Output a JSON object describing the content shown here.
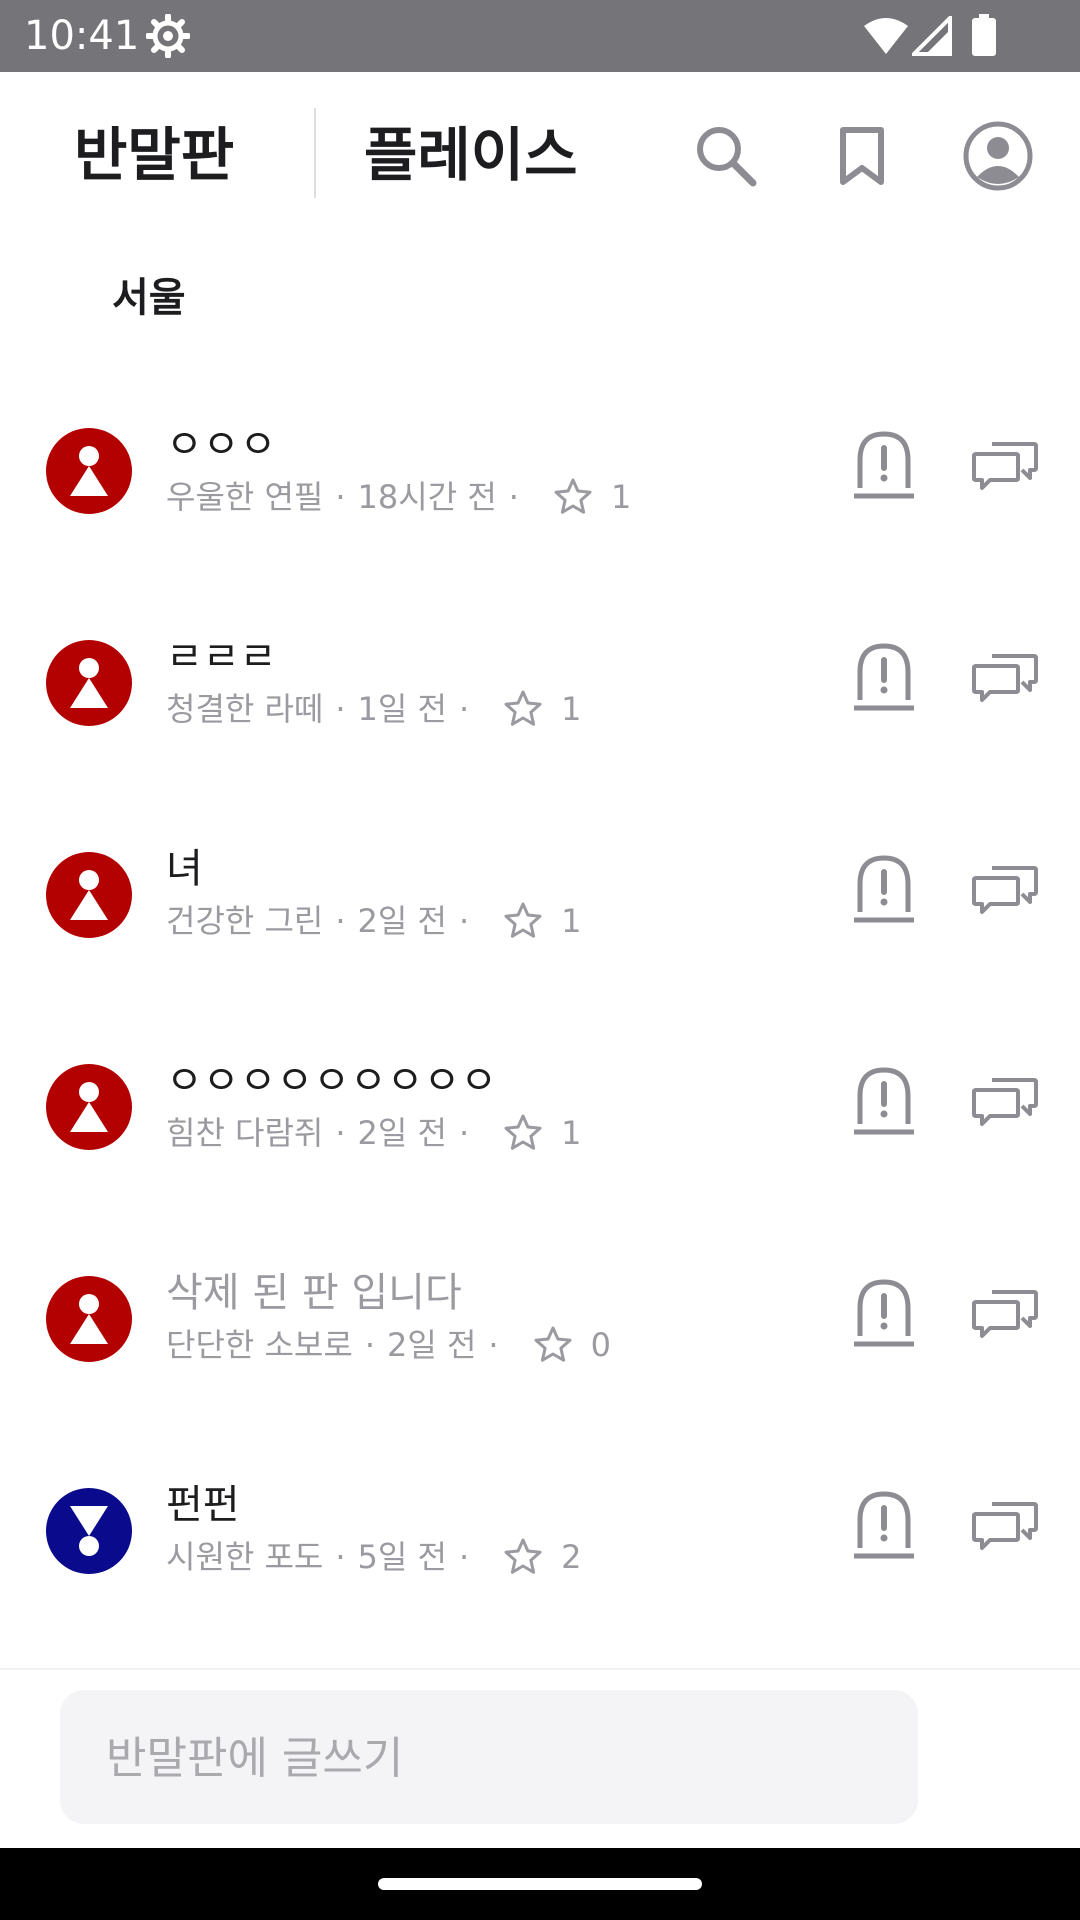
{
  "status_bar": {
    "time": "10:41",
    "icons": [
      "gear-icon",
      "wifi-icon",
      "signal-icon",
      "battery-icon"
    ]
  },
  "header": {
    "tabs": [
      {
        "label": "반말판",
        "active": true
      },
      {
        "label": "플레이스",
        "active": true
      }
    ],
    "actions": [
      "search-icon",
      "bookmark-icon",
      "profile-icon"
    ]
  },
  "region": "서울",
  "colors": {
    "avatar_red": "#b30000",
    "avatar_blue": "#0a0a8c",
    "meta_gray": "#9a9aa0",
    "icon_gray": "#8c8c92"
  },
  "posts": [
    {
      "title": "ㅇㅇㅇ",
      "author": "우울한 연필",
      "time": "18시간 전",
      "stars": "1",
      "avatar": "red-up",
      "deleted": false
    },
    {
      "title": "ㄹㄹㄹ",
      "author": "청결한 라떼",
      "time": "1일 전",
      "stars": "1",
      "avatar": "red-up",
      "deleted": false
    },
    {
      "title": "녀",
      "author": "건강한 그린",
      "time": "2일 전",
      "stars": "1",
      "avatar": "red-up",
      "deleted": false
    },
    {
      "title": "ㅇㅇㅇㅇㅇㅇㅇㅇㅇ",
      "author": "힘찬 다람쥐",
      "time": "2일 전",
      "stars": "1",
      "avatar": "red-up",
      "deleted": false
    },
    {
      "title": "삭제 된 판 입니다",
      "author": "단단한 소보로",
      "time": "2일 전",
      "stars": "0",
      "avatar": "red-up",
      "deleted": true
    },
    {
      "title": "펀펀",
      "author": "시원한 포도",
      "time": "5일 전",
      "stars": "2",
      "avatar": "blue-down",
      "deleted": false
    }
  ],
  "compose": {
    "placeholder": "반말판에 글쓰기"
  }
}
